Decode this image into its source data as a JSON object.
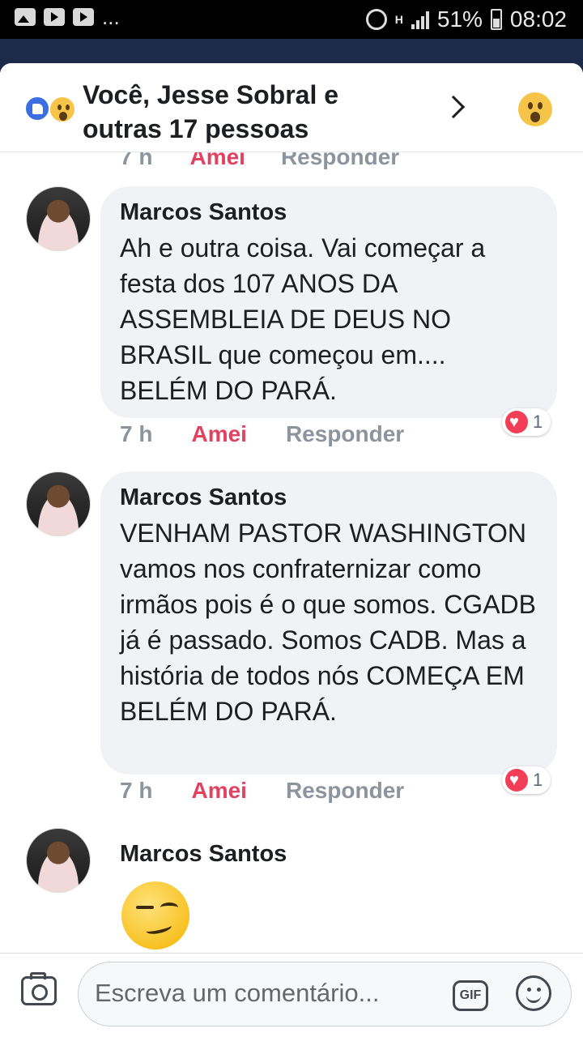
{
  "status_bar": {
    "notif_dots": "...",
    "network_label": "H",
    "battery": "51%",
    "time": "08:02"
  },
  "header": {
    "reactions_text": "Você, Jesse Sobral e outras 17 pessoas",
    "reaction_icons": [
      "like-icon",
      "wow-icon"
    ]
  },
  "previous_comment_meta": {
    "time": "7 h",
    "love_label": "Amei",
    "reply_label": "Responder"
  },
  "comments": [
    {
      "author": "Marcos Santos",
      "text": "Ah e outra coisa. Vai começar a festa dos 107 ANOS DA ASSEMBLEIA DE DEUS NO BRASIL que começou em.... BELÉM DO PARÁ.",
      "time": "7 h",
      "love_label": "Amei",
      "reply_label": "Responder",
      "reaction_count": "1"
    },
    {
      "author": "Marcos Santos",
      "text": "VENHAM PASTOR WASHINGTON vamos nos confraternizar como irmãos pois é o que somos. CGADB já é passado. Somos CADB. Mas a história de todos nós COMEÇA EM BELÉM DO PARÁ.",
      "time": "7 h",
      "love_label": "Amei",
      "reply_label": "Responder",
      "reaction_count": "1"
    },
    {
      "author": "Marcos Santos",
      "emoji": "smirking-face"
    }
  ],
  "composer": {
    "placeholder": "Escreva um comentário...",
    "gif_label": "GIF"
  },
  "colors": {
    "love": "#e4405f",
    "meta_gray": "#8d949e",
    "bubble": "#f0f2f5",
    "like_blue": "#3b6ee0"
  }
}
